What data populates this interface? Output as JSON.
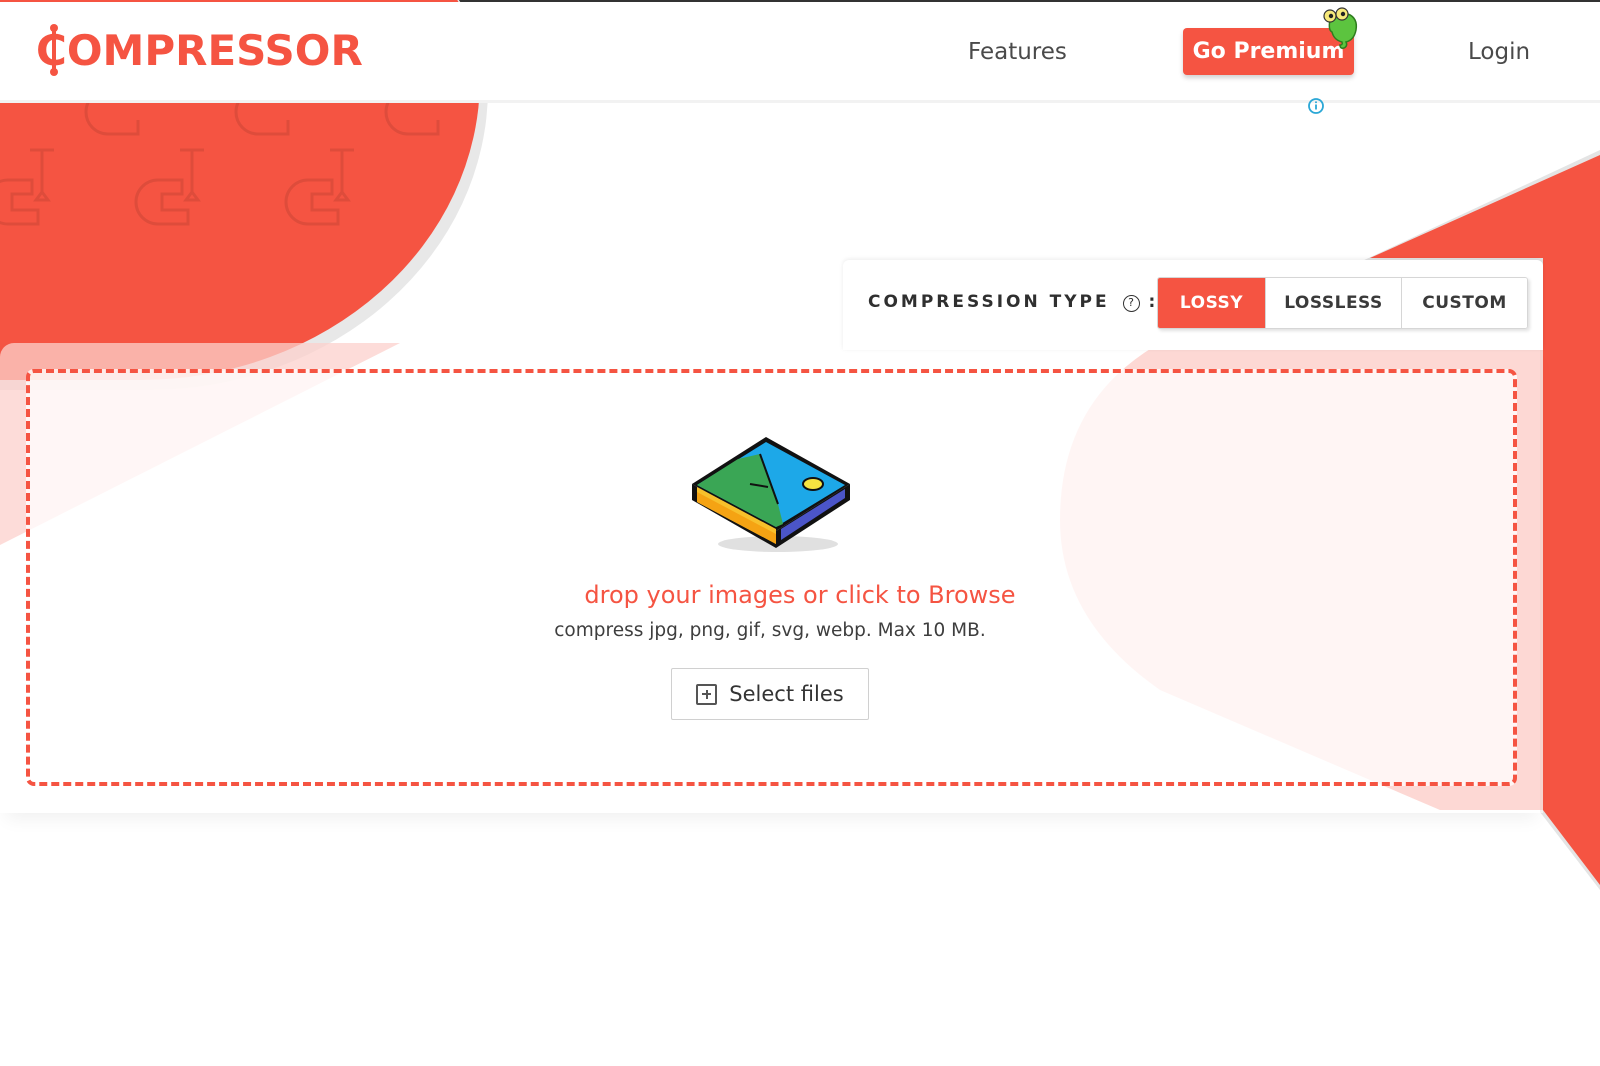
{
  "header": {
    "logo_text": "COMPRESSOR",
    "nav": {
      "features_label": "Features",
      "premium_label": "Go Premium",
      "login_label": "Login"
    },
    "mascot_icon": "chameleon-mascot-icon",
    "ad_info_icon": "info-icon"
  },
  "compression": {
    "label": "COMPRESSION TYPE",
    "help_glyph": "?",
    "colon": ":",
    "options": [
      {
        "label": "LOSSY",
        "active": true
      },
      {
        "label": "LOSSLESS",
        "active": false
      },
      {
        "label": "CUSTOM",
        "active": false
      }
    ]
  },
  "dropzone": {
    "illustration_icon": "image-stack-icon",
    "title": "drop your images or click to Browse",
    "subtitle": "compress jpg, png, gif, svg, webp. Max 10 MB.",
    "select_button_label": "Select files",
    "select_button_icon": "plus-square-icon"
  },
  "colors": {
    "brand": "#f55442",
    "text_dark": "#3e3e3e",
    "info_blue": "#2aa7d6"
  }
}
